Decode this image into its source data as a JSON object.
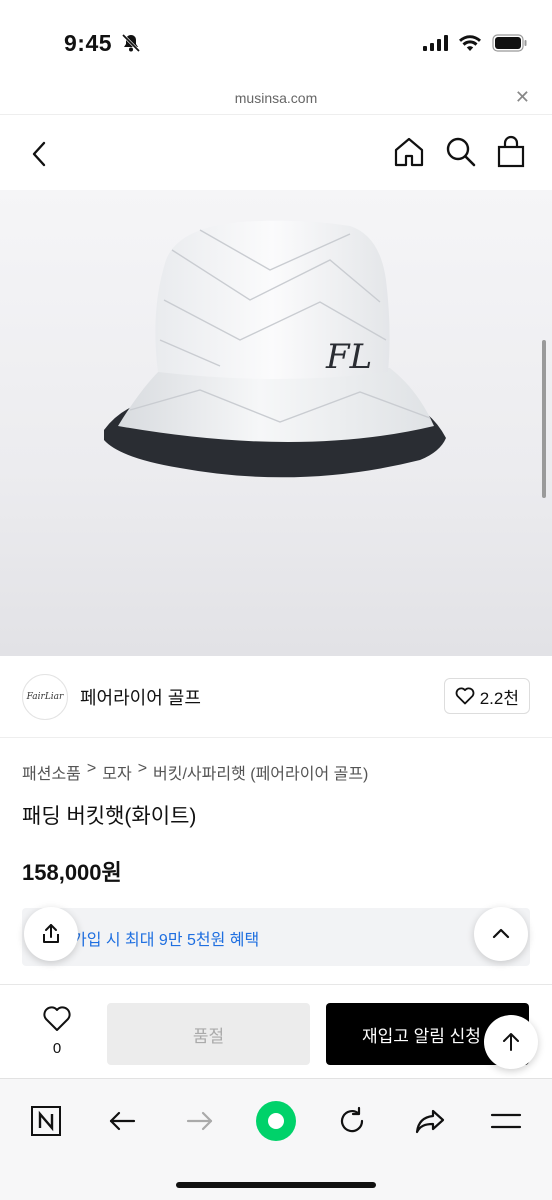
{
  "status": {
    "time": "9:45"
  },
  "browser": {
    "url": "musinsa.com"
  },
  "brand": {
    "name": "페어라이어 골프",
    "logo_text": "FairLiar",
    "likes": "2.2천"
  },
  "breadcrumb": [
    "패션소품",
    "모자",
    "버킷/사파리햇 (페어라이어 골프)"
  ],
  "breadcrumb_sep": ">",
  "product": {
    "title": "패딩 버킷햇(화이트)",
    "price": "158,000원"
  },
  "benefit": {
    "text": "가입 시 최대 9만 5천원 혜택"
  },
  "purchase": {
    "wish_count": "0",
    "soldout_label": "품절",
    "restock_label": "재입고 알림 신청"
  },
  "colors": {
    "accent_blue": "#1f6fe0",
    "nav_green": "#00d26a"
  }
}
